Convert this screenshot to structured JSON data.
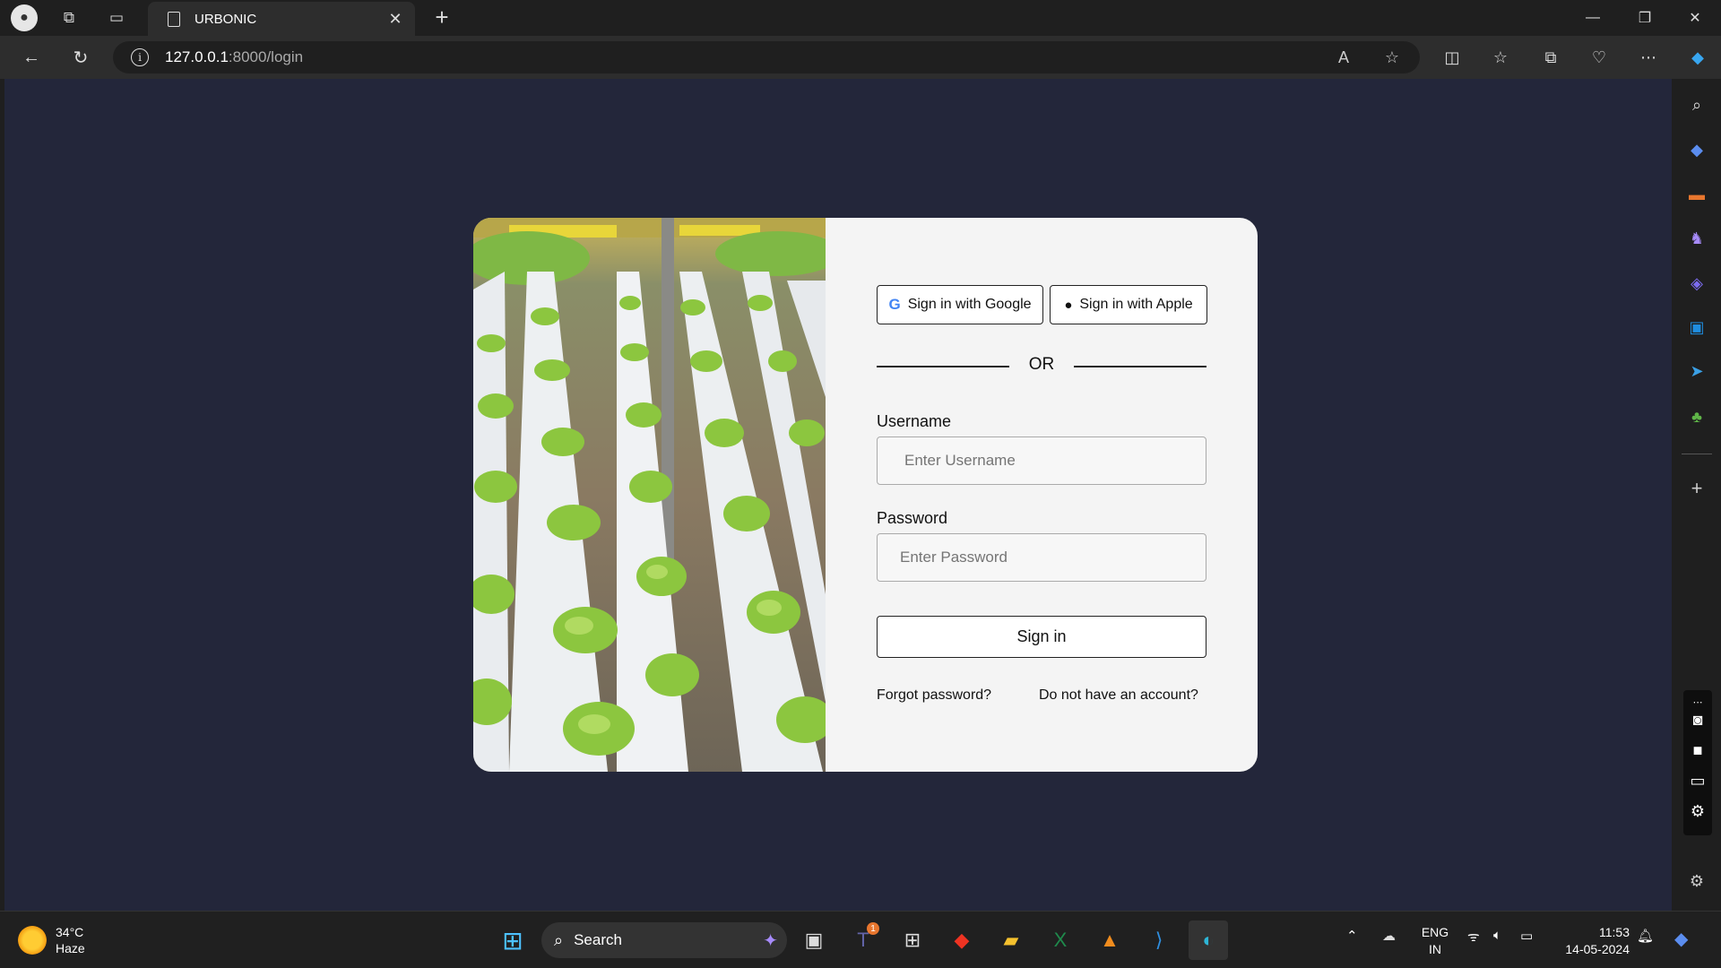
{
  "browser": {
    "tab_title": "URBONIC",
    "url_host": "127.0.0.1",
    "url_path": ":8000/login"
  },
  "login": {
    "google_button": "Sign in with Google",
    "apple_button": "Sign in with Apple",
    "divider_text": "OR",
    "username_label": "Username",
    "username_placeholder": "Enter Username",
    "password_label": "Password",
    "password_placeholder": "Enter Password",
    "signin_button": "Sign in",
    "forgot_link": "Forgot password?",
    "signup_link": "Do not have an account?"
  },
  "taskbar": {
    "weather_temp": "34°C",
    "weather_desc": "Haze",
    "search_label": "Search",
    "teams_badge": "1",
    "lang_line1": "ENG",
    "lang_line2": "IN",
    "time": "11:53",
    "date": "14-05-2024"
  },
  "colors": {
    "page_bg": "#23263a",
    "card_bg": "#f4f4f4",
    "taskbar_bg": "#202020"
  }
}
